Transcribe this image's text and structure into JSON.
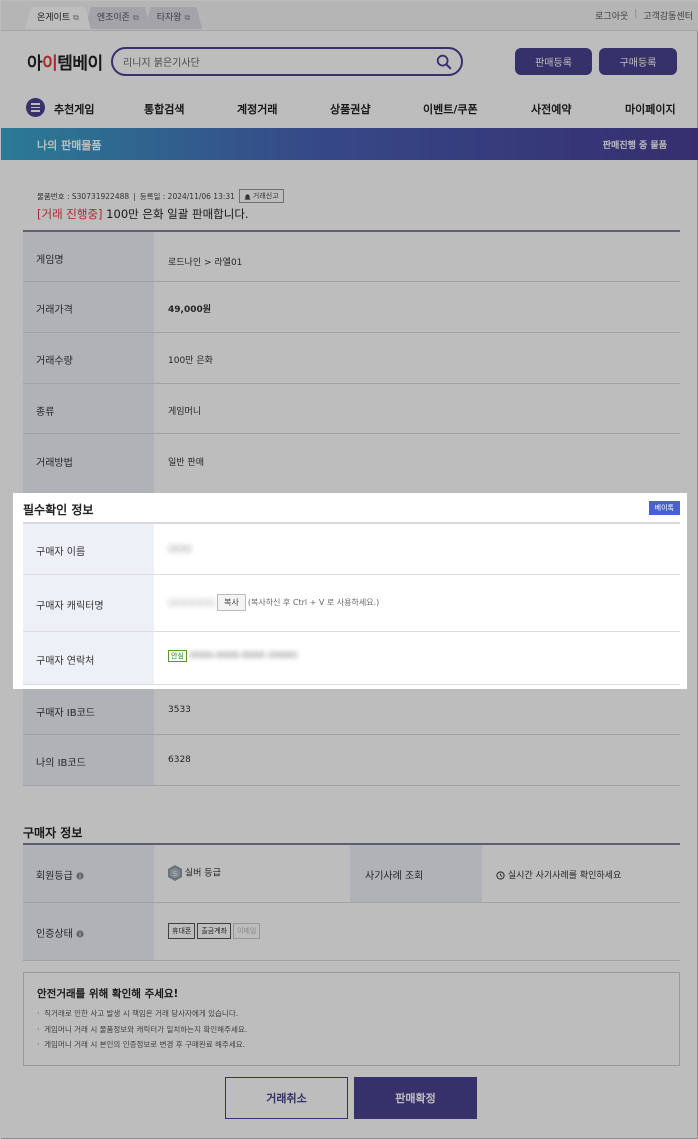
{
  "top_tabs": [
    {
      "label": "온게이트",
      "ext": "⧉"
    },
    {
      "label": "엔조이존",
      "ext": "⧉"
    },
    {
      "label": "타자왕",
      "ext": "⧉"
    }
  ],
  "top_links": {
    "logout": "로그아웃",
    "sep": "|",
    "support": "고객감동센터"
  },
  "logo": {
    "main": "아이템베이",
    "accent_char": "이"
  },
  "search": {
    "value": "리니지 붉은기사단"
  },
  "header_buttons": {
    "sell": "판매등록",
    "buy": "구매등록"
  },
  "nav": {
    "items": [
      "추천게임",
      "통합검색",
      "계정거래",
      "상품권샵",
      "이벤트/쿠폰",
      "사전예약",
      "마이페이지"
    ]
  },
  "banner": {
    "title": "나의 판매물품",
    "right": "판매진행 중 물품"
  },
  "item": {
    "meta_no": "물품번호 : S30731922488",
    "meta_sep": "|",
    "meta_date": "등록일 : 2024/11/06 13:31",
    "report": "거래신고",
    "status": "[거래 진행중]",
    "title": " 100만 은화 일괄 판매합니다."
  },
  "detail_rows": [
    {
      "label": "게임명",
      "value": "로드나인 > 라엘01"
    },
    {
      "label": "거래가격",
      "value": "49,000원"
    },
    {
      "label": "거래수량",
      "value": "100만 은화"
    },
    {
      "label": "종류",
      "value": "게임머니"
    },
    {
      "label": "거래방법",
      "value": "일반 판매"
    }
  ],
  "required": {
    "title": "필수확인 정보",
    "badge": "베이톡",
    "rows": [
      {
        "label": "구매자 이름",
        "value": "○○○"
      },
      {
        "label": "구매자 캐릭터명",
        "value": "○○○○○○",
        "copy": "복사",
        "hint": "(복사하신 후 Ctrl + V 로 사용하세요.)"
      },
      {
        "label": "구매자 연락처",
        "safety": "안심",
        "value": "0000-0000-0000 (0000)"
      }
    ]
  },
  "ib_rows": [
    {
      "label": "구매자 IB코드",
      "value": "3533"
    },
    {
      "label": "나의 IB코드",
      "value": "6328"
    }
  ],
  "buyer": {
    "title": "구매자 정보",
    "grade_label": "회원등급",
    "grade_value": "실버 등급",
    "fraud_label": "사기사례 조회",
    "fraud_value": "실시간 사기사례를 확인하세요",
    "auth_label": "인증상태",
    "auth_tags": [
      "휴대폰",
      "출금계좌",
      "이메일"
    ]
  },
  "notice": {
    "title": "안전거래를 위해 확인해 주세요!",
    "items": [
      "직거래로 인한 사고 발생 시 책임은 거래 당사자에게 있습니다.",
      "게임머니 거래 시 물품정보와 캐릭터가 일치하는지 확인해주세요.",
      "게임머니 거래 시 본인의 인증정보로 변경 후 구매완료 해주세요."
    ]
  },
  "actions": {
    "cancel": "거래취소",
    "confirm": "판매확정"
  },
  "colors": {
    "brand": "#4a4291",
    "status_red": "#e8383d",
    "price_purple": "#5b3fb8"
  }
}
